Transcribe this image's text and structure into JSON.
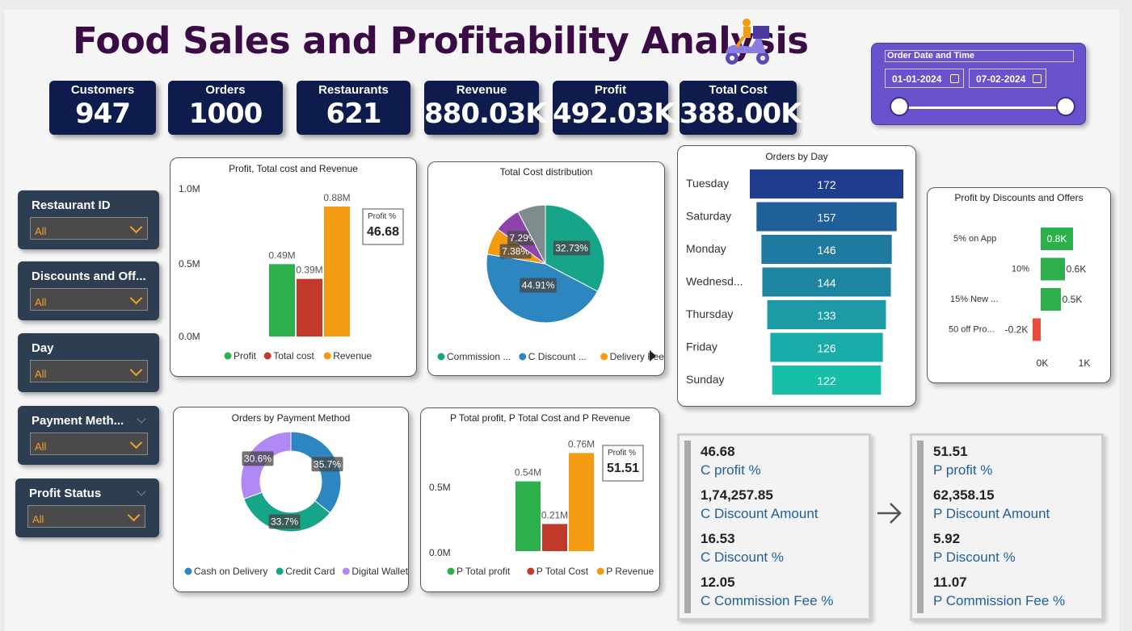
{
  "title": "Food Sales and Profitability Analysis",
  "kpis": [
    {
      "label": "Customers",
      "value": "947"
    },
    {
      "label": "Orders",
      "value": "1000"
    },
    {
      "label": "Restaurants",
      "value": "621"
    },
    {
      "label": "Revenue",
      "value": "880.03K"
    },
    {
      "label": "Profit",
      "value": "492.03K"
    },
    {
      "label": "Total Cost",
      "value": "388.00K"
    }
  ],
  "date_filter": {
    "label": "Order Date and Time",
    "start": "01-01-2024",
    "end": "07-02-2024"
  },
  "slicers": [
    {
      "label": "Restaurant ID",
      "value": "All"
    },
    {
      "label": "Discounts and Off...",
      "value": "All"
    },
    {
      "label": "Day",
      "value": "All"
    },
    {
      "label": "Payment Meth...",
      "value": "All"
    },
    {
      "label": "Profit Status",
      "value": "All"
    }
  ],
  "colors": {
    "profit": "#2db04b",
    "cost": "#c0392b",
    "revenue": "#f39c12",
    "kpi_bg": "#0e1b4d",
    "title": "#3b0b45"
  },
  "c_kpis": [
    {
      "value": "46.68",
      "label": "C profit %"
    },
    {
      "value": "1,74,257.85",
      "label": "C Discount Amount"
    },
    {
      "value": "16.53",
      "label": "C Discount %"
    },
    {
      "value": "12.05",
      "label": "C Commission Fee %"
    }
  ],
  "p_kpis": [
    {
      "value": "51.51",
      "label": "P profit %"
    },
    {
      "value": "62,358.15",
      "label": "P Discount Amount"
    },
    {
      "value": "5.92",
      "label": "P Discount %"
    },
    {
      "value": "11.07",
      "label": "P Commission Fee %"
    }
  ],
  "chart_data": [
    {
      "id": "pcr",
      "type": "bar",
      "title": "Profit, Total cost and Revenue",
      "categories": [
        "Profit",
        "Total cost",
        "Revenue"
      ],
      "values": [
        0.49,
        0.39,
        0.88
      ],
      "data_labels": [
        "0.49M",
        "0.39M",
        "0.88M"
      ],
      "colors": [
        "#2db04b",
        "#c0392b",
        "#f39c12"
      ],
      "yticks": [
        "1.0M",
        "0.5M",
        "0.0M"
      ],
      "ylim": [
        0,
        1.0
      ],
      "card_label": "Profit %",
      "card_value": "46.68",
      "legend": [
        "Profit",
        "Total cost",
        "Revenue"
      ]
    },
    {
      "id": "tcd",
      "type": "pie",
      "title": "Total Cost distribution",
      "values": [
        32.73,
        44.91,
        7.38,
        7.29,
        7.69
      ],
      "labels": [
        "32.73%",
        "44.91%",
        "7.38%",
        "7.29%",
        ""
      ],
      "colors": [
        "#17a589",
        "#2e86c1",
        "#f39c12",
        "#8e44ad",
        "#7f8c8d"
      ],
      "legend": [
        "Commission ...",
        "C Discount ...",
        "Delivery Fee"
      ]
    },
    {
      "id": "obd",
      "type": "bar",
      "title": "Orders by Day",
      "categories": [
        "Tuesday",
        "Saturday",
        "Monday",
        "Wednesd...",
        "Thursday",
        "Friday",
        "Sunday"
      ],
      "values": [
        172,
        157,
        146,
        144,
        133,
        126,
        122
      ],
      "colors": [
        "#1f3c8f",
        "#1f5f9a",
        "#1e7aa0",
        "#1e85a0",
        "#1c9aa6",
        "#1aaca8",
        "#17bfa8"
      ]
    },
    {
      "id": "pdo",
      "type": "bar",
      "title": "Profit by Discounts and Offers",
      "categories": [
        "5% on App",
        "10%",
        "15% New ...",
        "50 off Pro..."
      ],
      "values": [
        0.8,
        0.6,
        0.5,
        -0.2
      ],
      "data_labels": [
        "0.8K",
        "0.6K",
        "0.5K",
        "-0.2K"
      ],
      "xticks": [
        "0K",
        "1K"
      ]
    },
    {
      "id": "opm",
      "type": "pie",
      "title": "Orders by Payment Method",
      "values": [
        35.7,
        33.7,
        30.6
      ],
      "labels": [
        "35.7%",
        "33.7%",
        "30.6%"
      ],
      "colors": [
        "#2e86c1",
        "#17a589",
        "#b189f5"
      ],
      "legend": [
        "Cash on Delivery",
        "Credit Card",
        "Digital Wallet"
      ]
    },
    {
      "id": "ppcr",
      "type": "bar",
      "title": "P Total profit, P Total Cost and P Revenue",
      "categories": [
        "P Total profit",
        "P Total Cost",
        "P Revenue"
      ],
      "values": [
        0.54,
        0.21,
        0.76
      ],
      "data_labels": [
        "0.54M",
        "0.21M",
        "0.76M"
      ],
      "colors": [
        "#2db04b",
        "#c0392b",
        "#f39c12"
      ],
      "yticks": [
        "0.5M",
        "0.0M"
      ],
      "ylim": [
        0,
        1.0
      ],
      "card_label": "Profit %",
      "card_value": "51.51",
      "legend": [
        "P Total profit",
        "P Total Cost",
        "P Revenue"
      ]
    }
  ]
}
